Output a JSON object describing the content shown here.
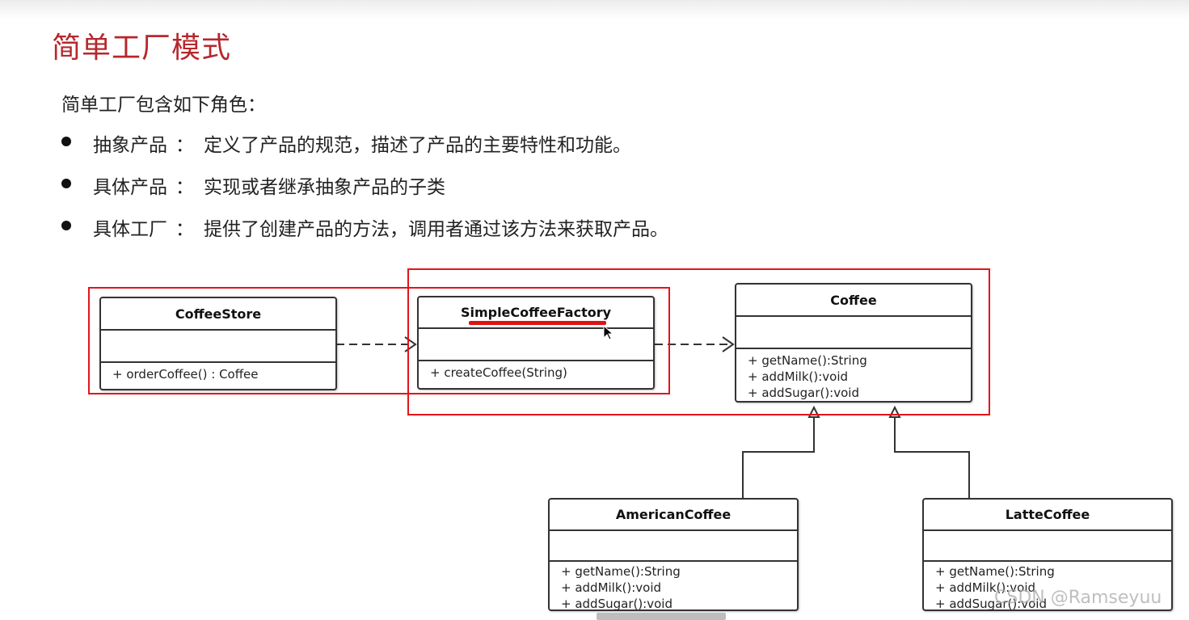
{
  "title": "简单工厂模式",
  "intro": "简单工厂包含如下角色：",
  "roles": [
    {
      "term": "抽象产品",
      "sep": "：",
      "desc": "定义了产品的规范，描述了产品的主要特性和功能。"
    },
    {
      "term": "具体产品",
      "sep": "：",
      "desc": "实现或者继承抽象产品的子类"
    },
    {
      "term": "具体工厂",
      "sep": "：",
      "desc": "提供了创建产品的方法，调用者通过该方法来获取产品。"
    }
  ],
  "diagram": {
    "classes": {
      "coffee_store": {
        "name": "CoffeeStore",
        "ops": [
          "+ orderCoffee() : Coffee"
        ]
      },
      "simple_coffee_factory": {
        "name": "SimpleCoffeeFactory",
        "ops": [
          "+ createCoffee(String)"
        ]
      },
      "coffee": {
        "name": "Coffee",
        "ops": [
          "+ getName():String",
          "+ addMilk():void",
          "+ addSugar():void"
        ]
      },
      "american_coffee": {
        "name": "AmericanCoffee",
        "ops": [
          "+ getName():String",
          "+ addMilk():void",
          "+ addSugar():void"
        ]
      },
      "latte_coffee": {
        "name": "LatteCoffee",
        "ops": [
          "+ getName():String",
          "+ addMilk():void",
          "+ addSugar():void"
        ]
      }
    },
    "highlight_color": "#e4141a"
  },
  "watermark": "CSDN @Ramseyuu"
}
